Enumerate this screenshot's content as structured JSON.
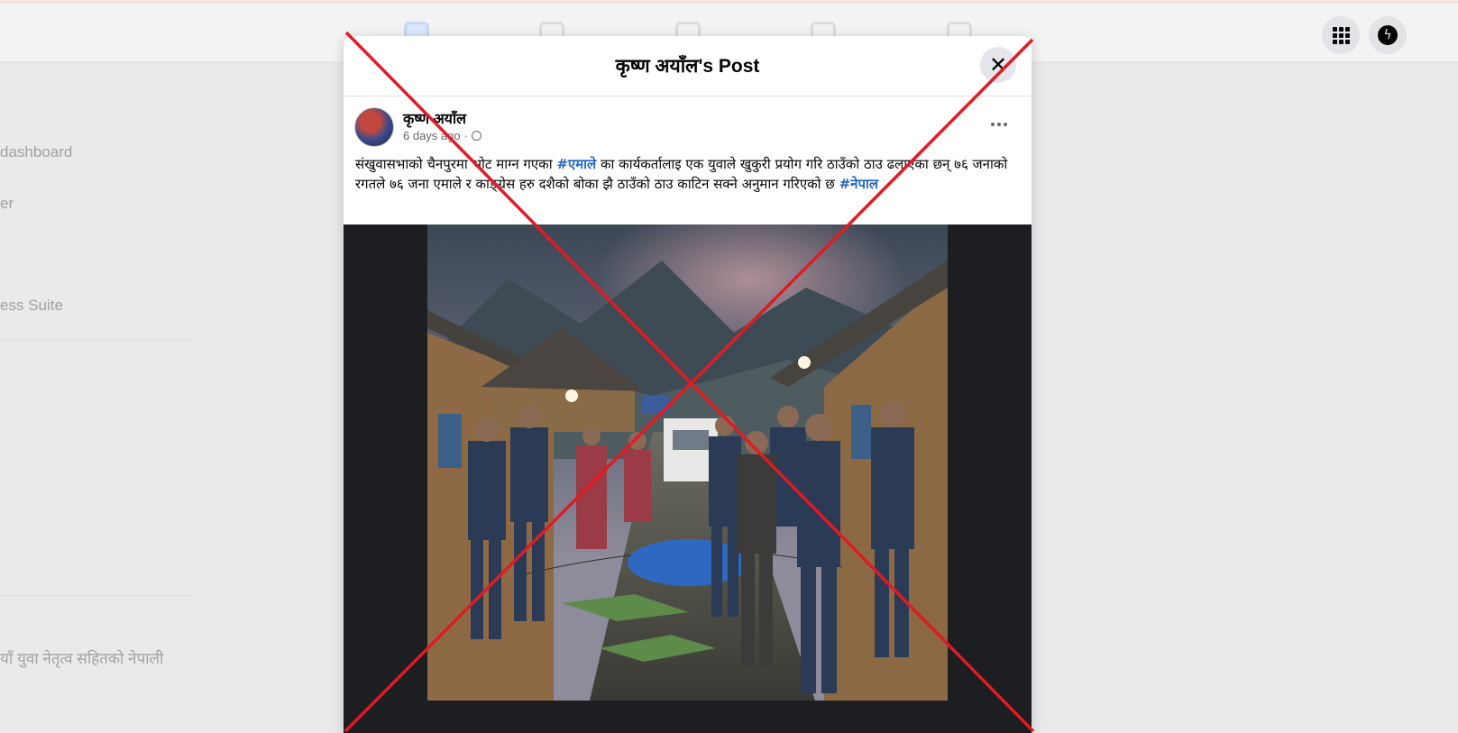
{
  "leftnav": {
    "items": [
      "dashboard",
      "er",
      "ess Suite",
      "याँ युवा नेतृत्व सहितको नेपाली"
    ]
  },
  "modal": {
    "title": "कृष्ण अयाँल's Post",
    "close_symbol": "✕"
  },
  "post": {
    "author": "कृष्ण अयाँल",
    "time": "6 days ago",
    "separator": "·",
    "text_part1": "संखुवासभाको चैनपुरमा भोट माग्न गएका ",
    "hashtag1": "#एमाले",
    "text_part2": " का कार्यकर्तालाइ एक युवाले खुकुरी प्रयोग गरि ठाउँको ठाउ ढलाएका छन्  ७६ जनाको रगतले ७६ जना एमाले र काङ्ग्रेस हरु दशैको बोका झै ठाउँको ठाउ काटिन सक्ने अनुमान गरिएको छ ",
    "hashtag2": "#नेपाल"
  },
  "icons": {
    "menu": "apps-grid-icon",
    "messenger": "messenger-icon",
    "close": "close-icon",
    "more": "more-options-icon",
    "privacy": "globe-icon"
  },
  "colors": {
    "hashtag": "#2267c8",
    "overlay_cross": "#e01b24",
    "modal_bg": "#ffffff"
  }
}
